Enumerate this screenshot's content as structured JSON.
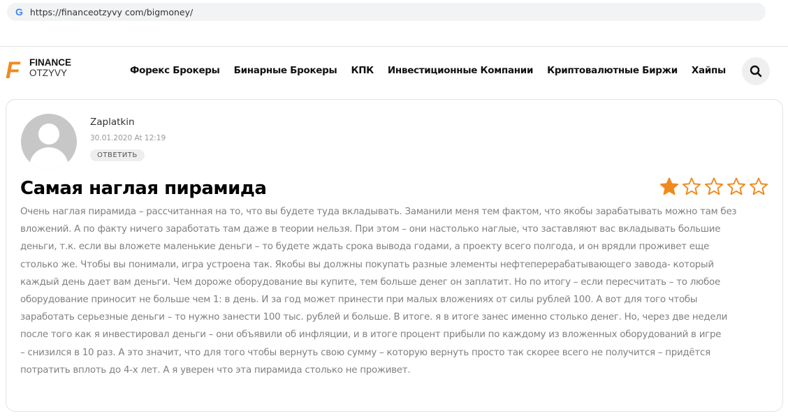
{
  "browser": {
    "url": "https://financeotzyvy com/bigmoney/"
  },
  "logo": {
    "line1": "FINANCE",
    "line2": "OTZYVY",
    "mark": "F"
  },
  "nav": [
    "Форекс Брокеры",
    "Бинарные Брокеры",
    "КПК",
    "Инвестиционные Компании",
    "Криптовалютные Биржи",
    "Хайпы"
  ],
  "review": {
    "author": "Zaplatkin",
    "date": "30.01.2020 At 12:19",
    "reply_label": "ОТВЕТИТЬ",
    "title": "Самая наглая пирамида",
    "rating": 1,
    "rating_max": 5,
    "star_color": "#f08a1e",
    "lines": [
      "Очень наглая пирамида – рассчитанная на то, что вы будете туда вкладывать. Заманили меня тем фактом, что якобы зарабатывать можно там без",
      "вложений. А по факту ничего заработать там даже в теории нельзя. При этом – они настолько наглые, что заставляют вас вкладывать большие",
      "деньги, т.к. если вы вложете маленькие деньги – то будете ждать срока вывода годами, а проекту всего полгода, и он врядли проживет еще",
      "столько же. Чтобы вы понимали, игра устроена так. Якобы вы должны покупать разные элементы нефтеперерабатывающего завода- который",
      "каждый день дает вам деньги. Чем дороже оборудование вы купите, тем больше денег он заплатит. Но по итогу – если пересчитать – то любое",
      "оборудование приносит не больше чем 1: в день. И за год может принести при малых вложениях от силы рублей 100. А вот для того чтобы",
      "заработать серьезные деньги – то нужно занести 100 тыс. рублей и больше. В итоге. я в итоге занес именно столько денег. Но, через две недели",
      "после того как я инвестировал деньги – они объявили об инфляции, и в итоге процент прибыли по каждому из вложенных оборудований в игре",
      "– снизился в 10 раз. А это значит, что для того чтобы вернуть свою сумму – которую вернуть просто так скорее всего не получится – придётся",
      "потратить вплоть до 4-х лет. А я уверен что эта пирамида столько не проживет."
    ]
  }
}
